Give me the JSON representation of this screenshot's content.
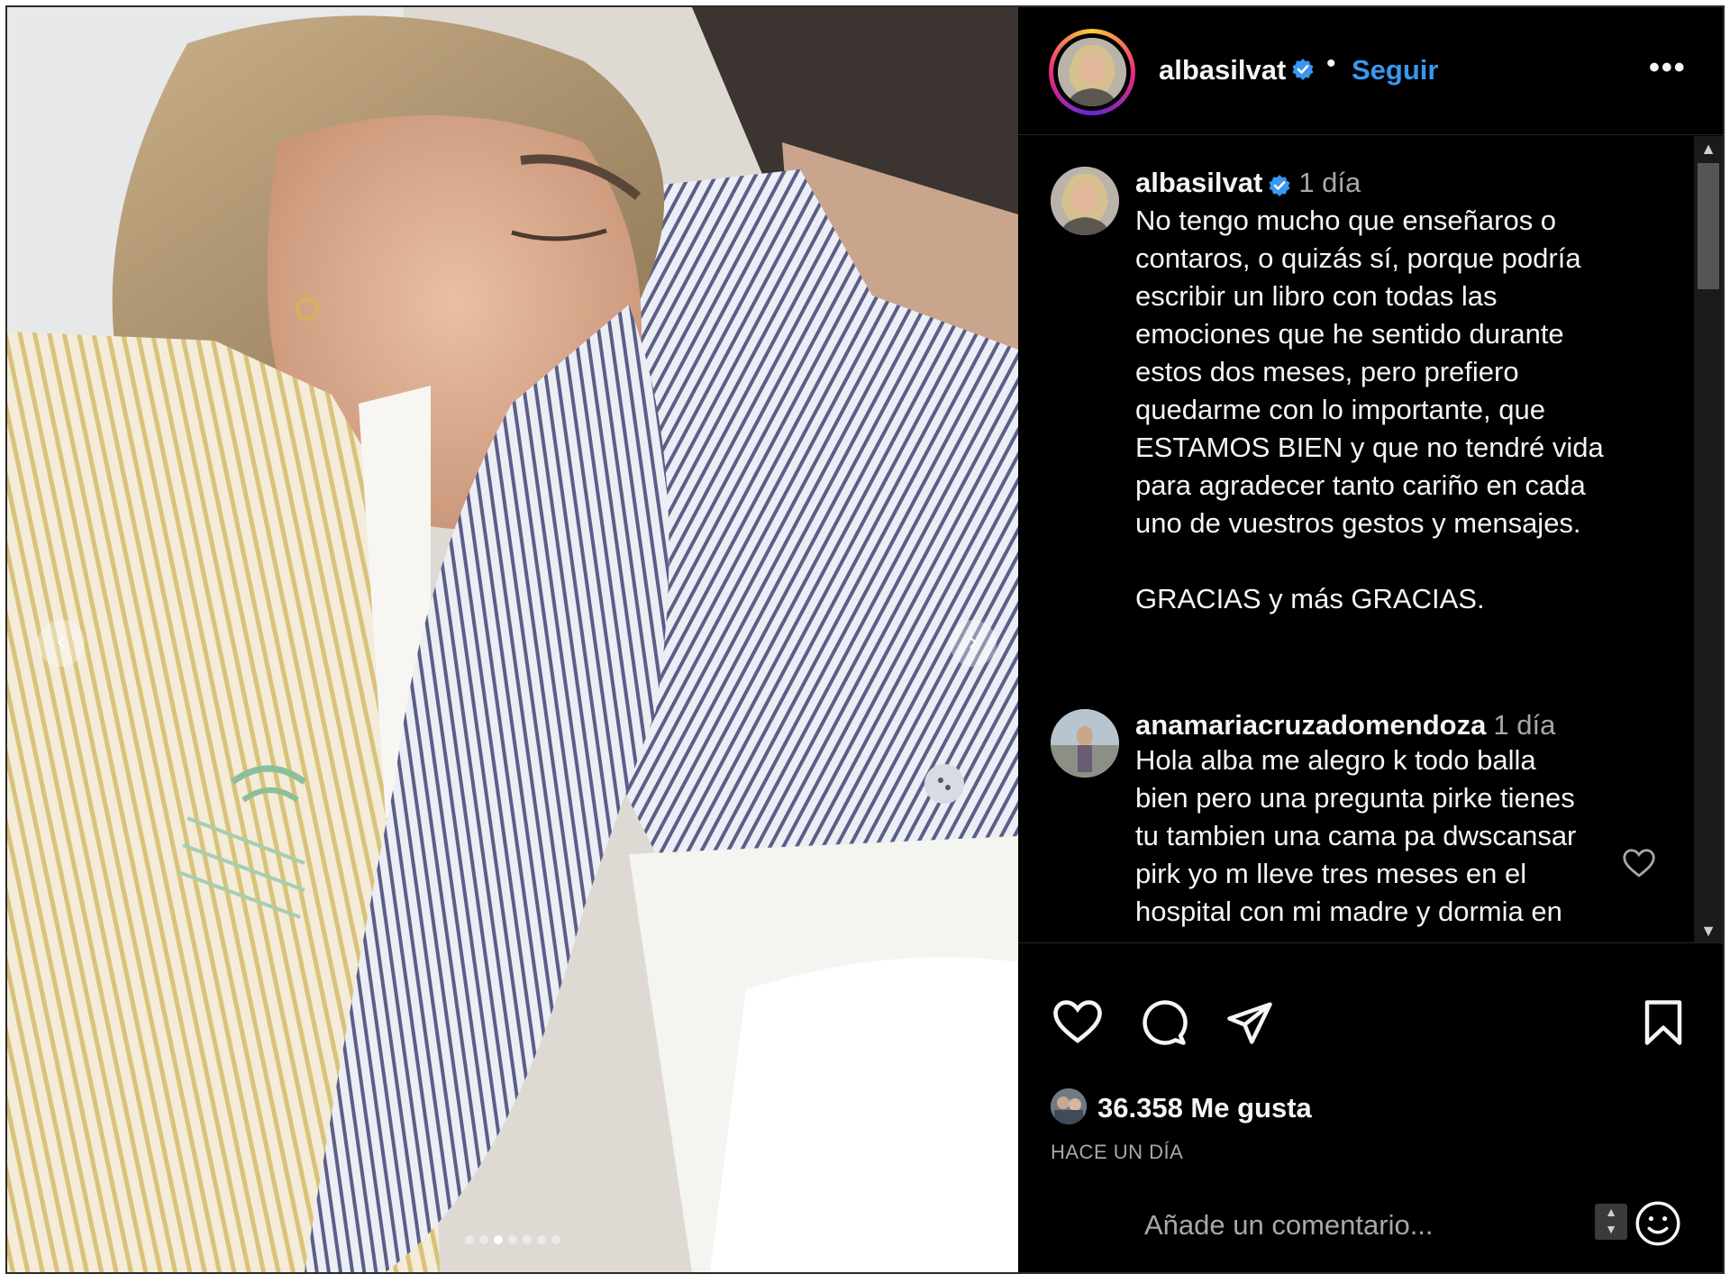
{
  "post": {
    "author": "albasilvat",
    "follow_label": "Seguir",
    "separator": "•",
    "more_label": "•••",
    "caption_time": "1 día",
    "caption_text": "No tengo mucho que enseñaros o\ncontaros, o quizás sí, porque podría\nescribir un libro con todas las\nemociones que he sentido durante\nestos dos meses, pero prefiero\nquedarme con lo importante, que\nESTAMOS BIEN y que no tendré vida\npara agradecer tanto cariño en cada\nuno de vuestros gestos y mensajes.\n\nGRACIAS y más GRACIAS.",
    "likes": "36.358 Me gusta",
    "timestamp": "HACE UN DÍA"
  },
  "comments": [
    {
      "user": "anamariacruzadomendoza",
      "time": "1 día",
      "text": "Hola alba me alegro k todo balla\nbien pero una pregunta pirke tienes\ntu tambien una cama pa dwscansar\npirk yo m lleve tres meses en el\nhospital con mi madre y dormia en"
    }
  ],
  "add_comment": {
    "placeholder": "Añade un comentario..."
  },
  "carousel": {
    "prev_label": "‹",
    "next_label": "›",
    "slides": 7,
    "active_slide": 2
  },
  "colors": {
    "background": "#000000",
    "text": "#f5f5f5",
    "muted": "#a8a8a8",
    "link": "#3897f0",
    "verified": "#3897f0"
  },
  "icons": {
    "verified": "verified-badge-icon",
    "like": "heart-icon",
    "comment": "comment-bubble-icon",
    "share": "paper-plane-icon",
    "save": "bookmark-icon",
    "emoji": "smiley-icon"
  }
}
